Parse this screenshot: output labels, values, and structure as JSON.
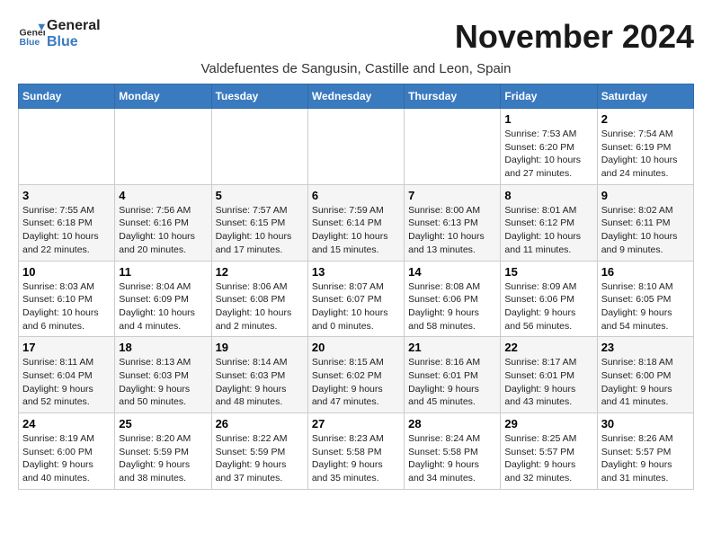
{
  "header": {
    "logo_line1": "General",
    "logo_line2": "Blue",
    "month_year": "November 2024",
    "location": "Valdefuentes de Sangusin, Castille and Leon, Spain"
  },
  "weekdays": [
    "Sunday",
    "Monday",
    "Tuesday",
    "Wednesday",
    "Thursday",
    "Friday",
    "Saturday"
  ],
  "weeks": [
    [
      {
        "day": "",
        "info": ""
      },
      {
        "day": "",
        "info": ""
      },
      {
        "day": "",
        "info": ""
      },
      {
        "day": "",
        "info": ""
      },
      {
        "day": "",
        "info": ""
      },
      {
        "day": "1",
        "info": "Sunrise: 7:53 AM\nSunset: 6:20 PM\nDaylight: 10 hours and 27 minutes."
      },
      {
        "day": "2",
        "info": "Sunrise: 7:54 AM\nSunset: 6:19 PM\nDaylight: 10 hours and 24 minutes."
      }
    ],
    [
      {
        "day": "3",
        "info": "Sunrise: 7:55 AM\nSunset: 6:18 PM\nDaylight: 10 hours and 22 minutes."
      },
      {
        "day": "4",
        "info": "Sunrise: 7:56 AM\nSunset: 6:16 PM\nDaylight: 10 hours and 20 minutes."
      },
      {
        "day": "5",
        "info": "Sunrise: 7:57 AM\nSunset: 6:15 PM\nDaylight: 10 hours and 17 minutes."
      },
      {
        "day": "6",
        "info": "Sunrise: 7:59 AM\nSunset: 6:14 PM\nDaylight: 10 hours and 15 minutes."
      },
      {
        "day": "7",
        "info": "Sunrise: 8:00 AM\nSunset: 6:13 PM\nDaylight: 10 hours and 13 minutes."
      },
      {
        "day": "8",
        "info": "Sunrise: 8:01 AM\nSunset: 6:12 PM\nDaylight: 10 hours and 11 minutes."
      },
      {
        "day": "9",
        "info": "Sunrise: 8:02 AM\nSunset: 6:11 PM\nDaylight: 10 hours and 9 minutes."
      }
    ],
    [
      {
        "day": "10",
        "info": "Sunrise: 8:03 AM\nSunset: 6:10 PM\nDaylight: 10 hours and 6 minutes."
      },
      {
        "day": "11",
        "info": "Sunrise: 8:04 AM\nSunset: 6:09 PM\nDaylight: 10 hours and 4 minutes."
      },
      {
        "day": "12",
        "info": "Sunrise: 8:06 AM\nSunset: 6:08 PM\nDaylight: 10 hours and 2 minutes."
      },
      {
        "day": "13",
        "info": "Sunrise: 8:07 AM\nSunset: 6:07 PM\nDaylight: 10 hours and 0 minutes."
      },
      {
        "day": "14",
        "info": "Sunrise: 8:08 AM\nSunset: 6:06 PM\nDaylight: 9 hours and 58 minutes."
      },
      {
        "day": "15",
        "info": "Sunrise: 8:09 AM\nSunset: 6:06 PM\nDaylight: 9 hours and 56 minutes."
      },
      {
        "day": "16",
        "info": "Sunrise: 8:10 AM\nSunset: 6:05 PM\nDaylight: 9 hours and 54 minutes."
      }
    ],
    [
      {
        "day": "17",
        "info": "Sunrise: 8:11 AM\nSunset: 6:04 PM\nDaylight: 9 hours and 52 minutes."
      },
      {
        "day": "18",
        "info": "Sunrise: 8:13 AM\nSunset: 6:03 PM\nDaylight: 9 hours and 50 minutes."
      },
      {
        "day": "19",
        "info": "Sunrise: 8:14 AM\nSunset: 6:03 PM\nDaylight: 9 hours and 48 minutes."
      },
      {
        "day": "20",
        "info": "Sunrise: 8:15 AM\nSunset: 6:02 PM\nDaylight: 9 hours and 47 minutes."
      },
      {
        "day": "21",
        "info": "Sunrise: 8:16 AM\nSunset: 6:01 PM\nDaylight: 9 hours and 45 minutes."
      },
      {
        "day": "22",
        "info": "Sunrise: 8:17 AM\nSunset: 6:01 PM\nDaylight: 9 hours and 43 minutes."
      },
      {
        "day": "23",
        "info": "Sunrise: 8:18 AM\nSunset: 6:00 PM\nDaylight: 9 hours and 41 minutes."
      }
    ],
    [
      {
        "day": "24",
        "info": "Sunrise: 8:19 AM\nSunset: 6:00 PM\nDaylight: 9 hours and 40 minutes."
      },
      {
        "day": "25",
        "info": "Sunrise: 8:20 AM\nSunset: 5:59 PM\nDaylight: 9 hours and 38 minutes."
      },
      {
        "day": "26",
        "info": "Sunrise: 8:22 AM\nSunset: 5:59 PM\nDaylight: 9 hours and 37 minutes."
      },
      {
        "day": "27",
        "info": "Sunrise: 8:23 AM\nSunset: 5:58 PM\nDaylight: 9 hours and 35 minutes."
      },
      {
        "day": "28",
        "info": "Sunrise: 8:24 AM\nSunset: 5:58 PM\nDaylight: 9 hours and 34 minutes."
      },
      {
        "day": "29",
        "info": "Sunrise: 8:25 AM\nSunset: 5:57 PM\nDaylight: 9 hours and 32 minutes."
      },
      {
        "day": "30",
        "info": "Sunrise: 8:26 AM\nSunset: 5:57 PM\nDaylight: 9 hours and 31 minutes."
      }
    ]
  ]
}
